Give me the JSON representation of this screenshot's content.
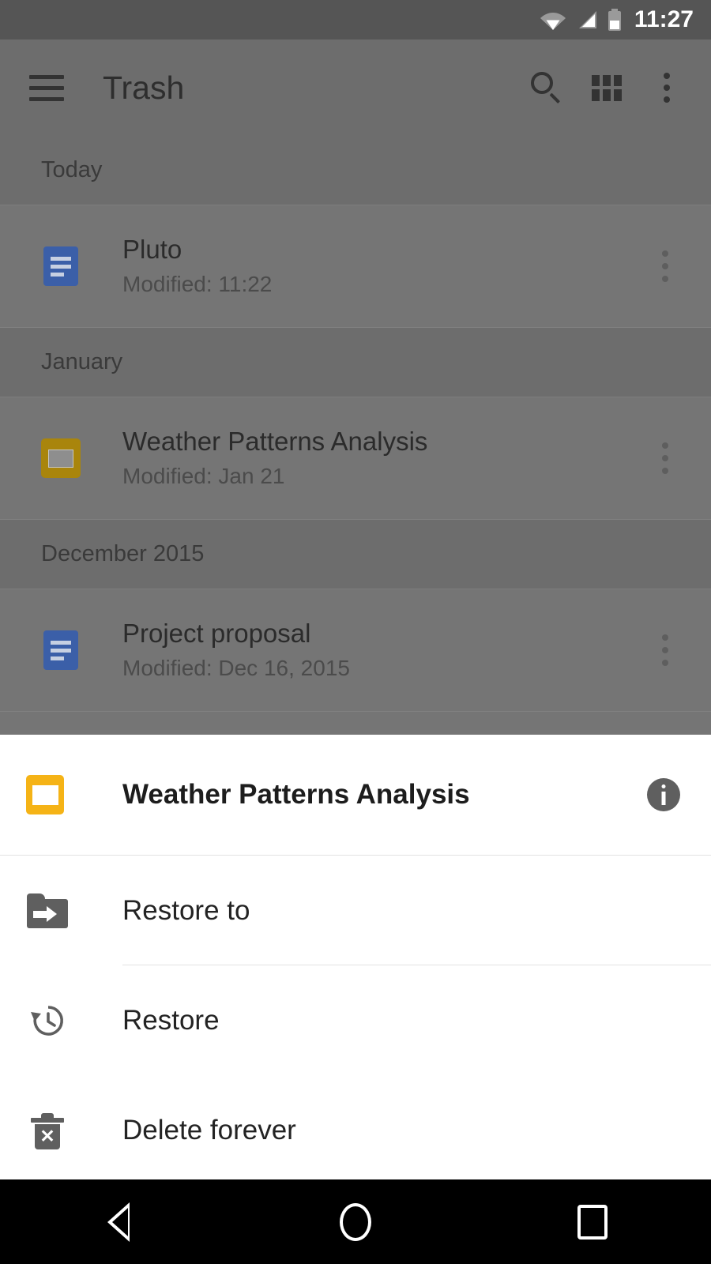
{
  "status_bar": {
    "clock": "11:27",
    "icons": [
      "wifi-icon",
      "cell-signal-icon",
      "battery-icon"
    ]
  },
  "toolbar": {
    "menu_icon": "hamburger-menu-icon",
    "title": "Trash",
    "search_icon": "search-icon",
    "grid_view_icon": "grid-view-icon",
    "overflow_icon": "overflow-menu-icon"
  },
  "file_list": {
    "sections": [
      {
        "label": "Today",
        "items": [
          {
            "name": "Pluto",
            "modified": "Modified: 11:22",
            "icon": "google-docs-icon",
            "icon_color": "#3b5fa8"
          }
        ]
      },
      {
        "label": "January",
        "items": [
          {
            "name": "Weather Patterns Analysis",
            "modified": "Modified: Jan 21",
            "icon": "google-slides-icon",
            "icon_color": "#a9850c"
          }
        ]
      },
      {
        "label": "December 2015",
        "items": [
          {
            "name": "Project proposal",
            "modified": "Modified: Dec 16, 2015",
            "icon": "google-docs-icon",
            "icon_color": "#3b5fa8"
          }
        ]
      }
    ]
  },
  "bottom_sheet": {
    "file_icon": "google-slides-icon",
    "file_icon_color": "#f5b316",
    "file_title": "Weather Patterns Analysis",
    "info_icon": "info-icon",
    "actions": [
      {
        "label": "Restore to",
        "icon": "folder-move-icon"
      },
      {
        "label": "Restore",
        "icon": "restore-history-icon"
      },
      {
        "label": "Delete forever",
        "icon": "delete-forever-icon"
      }
    ]
  },
  "nav_bar": {
    "back_icon": "back-triangle-icon",
    "home_icon": "home-circle-icon",
    "recents_icon": "recents-square-icon"
  },
  "colors": {
    "status_bar_bg": "#555555",
    "toolbar_scrim_bg": "#6d6d6d",
    "list_scrim_bg": "#757575",
    "sheet_bg": "#ffffff",
    "nav_bar_bg": "#000000",
    "icon_grey": "#5f5f5f"
  }
}
